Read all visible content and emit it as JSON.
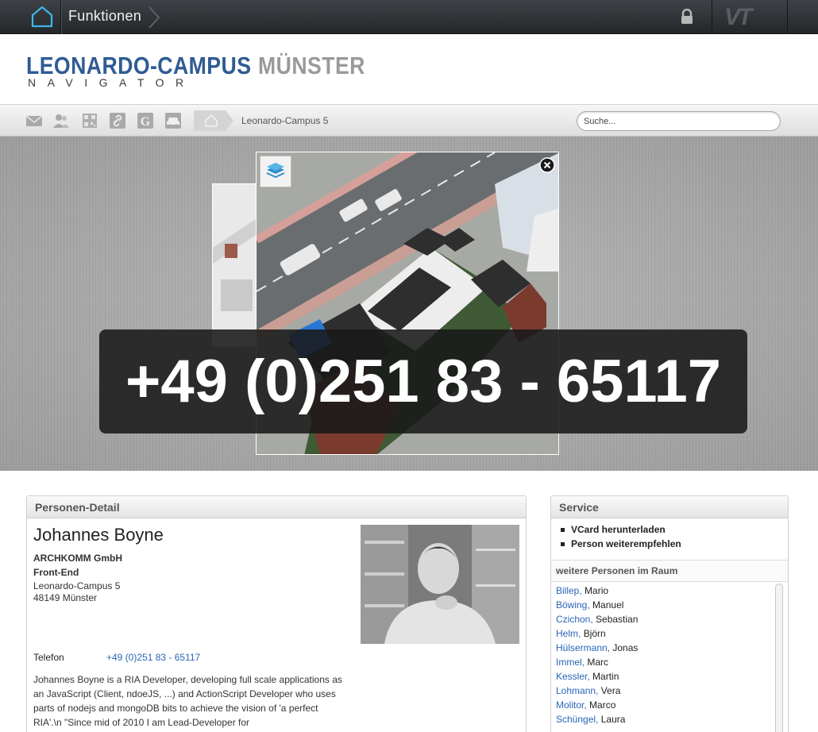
{
  "topbar": {
    "functions_label": "Funktionen",
    "vt_logo": "VT",
    "icons": [
      "home-icon",
      "lock-icon"
    ]
  },
  "header": {
    "logo_part1": "LEONARDO-CAMPUS",
    "logo_part2": "MÜNSTER",
    "logo_sub": "NAVIGATOR"
  },
  "toolbar": {
    "icons": [
      "mail-icon",
      "people-icon",
      "qr-code-icon",
      "link-icon",
      "google-icon",
      "car-icon"
    ],
    "breadcrumb": "Leonardo-Campus 5",
    "search_placeholder": "Suche..."
  },
  "hero": {
    "phone_overlay": "+49 (0)251 83 - 65117"
  },
  "person_panel": {
    "title": "Personen-Detail",
    "name": "Johannes Boyne",
    "company": "ARCHKOMM GmbH",
    "role": "Front-End",
    "street": "Leonardo-Campus 5",
    "city": "48149 Münster",
    "phone_label": "Telefon",
    "phone_value": "+49 (0)251 83 - 65117",
    "bio": "Johannes Boyne is a RIA Developer, developing full scale applications as an JavaScript (Client, ndoeJS, ...) and ActionScript Developer who uses parts of nodejs and mongoDB bits to achieve the vision of 'a perfect RIA'.\\n \"Since mid of 2010 I am Lead-Developer for"
  },
  "service_panel": {
    "title": "Service",
    "items": [
      "VCard herunterladen",
      "Person weiterempfehlen"
    ],
    "people_title": "weitere Personen im Raum",
    "people": [
      {
        "last": "Billep,",
        "first": "Mario"
      },
      {
        "last": "Böwing,",
        "first": "Manuel"
      },
      {
        "last": "Czichon,",
        "first": "Sebastian"
      },
      {
        "last": "Helm,",
        "first": "Björn"
      },
      {
        "last": "Hülsermann,",
        "first": "Jonas"
      },
      {
        "last": "Immel,",
        "first": "Marc"
      },
      {
        "last": "Kessler,",
        "first": "Martin"
      },
      {
        "last": "Lohmann,",
        "first": "Vera"
      },
      {
        "last": "Molitor,",
        "first": "Marco"
      },
      {
        "last": "Schüngel,",
        "first": "Laura"
      }
    ]
  }
}
